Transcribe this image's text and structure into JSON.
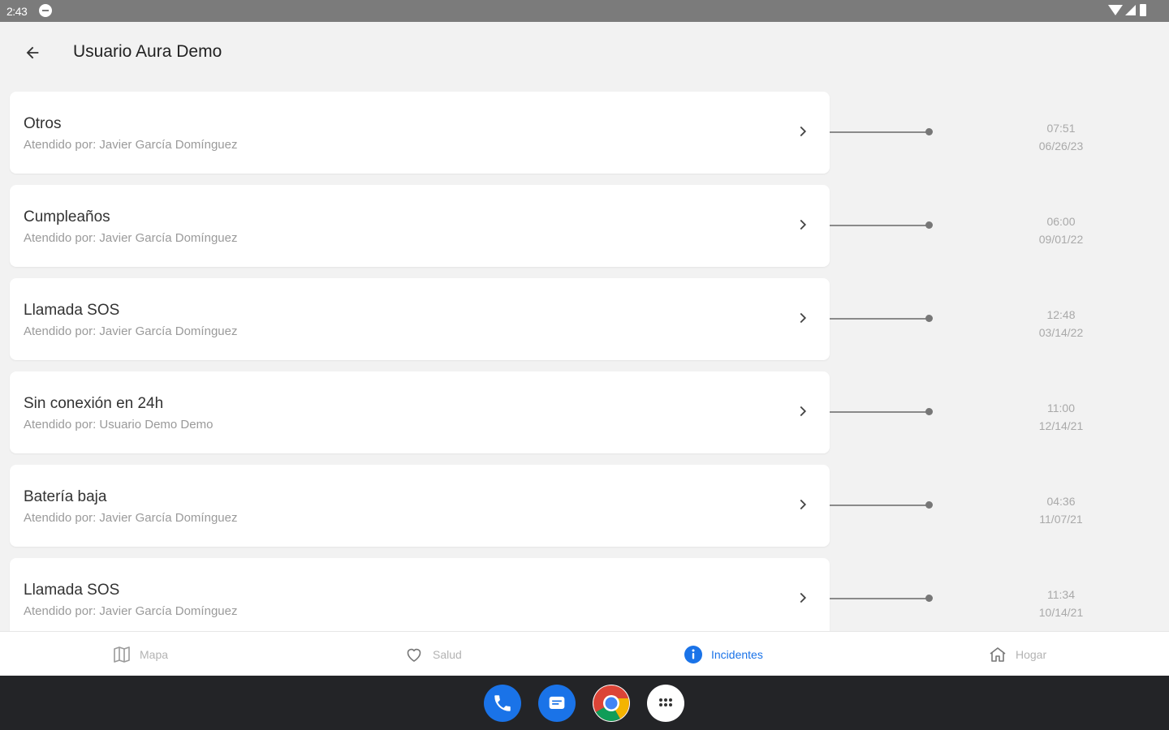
{
  "status_bar": {
    "time": "2:43"
  },
  "header": {
    "title": "Usuario Aura Demo"
  },
  "incidents": [
    {
      "title": "Otros",
      "subtitle": "Atendido por: Javier García Domínguez",
      "time": "07:51",
      "date": "06/26/23"
    },
    {
      "title": "Cumpleaños",
      "subtitle": "Atendido por: Javier García Domínguez",
      "time": "06:00",
      "date": "09/01/22"
    },
    {
      "title": "Llamada SOS",
      "subtitle": "Atendido por: Javier García Domínguez",
      "time": "12:48",
      "date": "03/14/22"
    },
    {
      "title": "Sin conexión en 24h",
      "subtitle": "Atendido por: Usuario Demo Demo",
      "time": "11:00",
      "date": "12/14/21"
    },
    {
      "title": "Batería baja",
      "subtitle": "Atendido por: Javier García Domínguez",
      "time": "04:36",
      "date": "11/07/21"
    },
    {
      "title": "Llamada SOS",
      "subtitle": "Atendido por: Javier García Domínguez",
      "time": "11:34",
      "date": "10/14/21"
    }
  ],
  "bottom_nav": [
    {
      "label": "Mapa",
      "icon": "map-icon",
      "active": false
    },
    {
      "label": "Salud",
      "icon": "heart-icon",
      "active": false
    },
    {
      "label": "Incidentes",
      "icon": "info-icon",
      "active": true
    },
    {
      "label": "Hogar",
      "icon": "home-icon",
      "active": false
    }
  ],
  "dock": [
    "phone-icon",
    "messages-icon",
    "chrome-icon",
    "app-drawer-icon"
  ],
  "colors": {
    "accent": "#1a73e8",
    "background": "#f2f2f2",
    "status_bar": "#7b7b7b",
    "dock": "#232427"
  }
}
